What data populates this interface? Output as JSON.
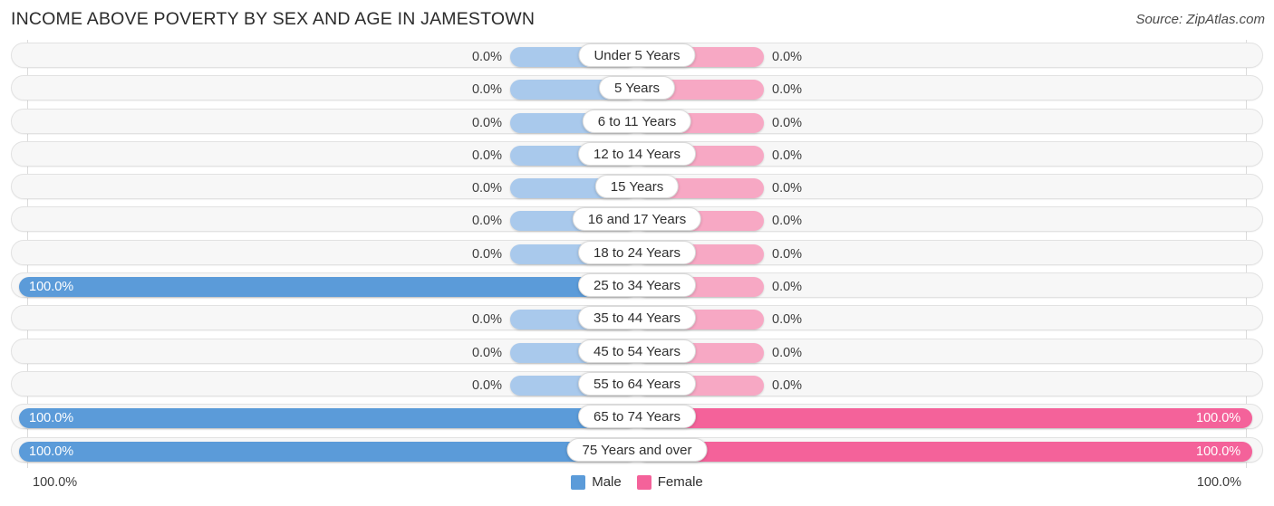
{
  "header": {
    "title": "INCOME ABOVE POVERTY BY SEX AND AGE IN JAMESTOWN",
    "source": "Source: ZipAtlas.com"
  },
  "legend": {
    "male_label": "Male",
    "female_label": "Female",
    "male_color": "#5b9bd9",
    "female_color": "#f4629a",
    "male_zero_color": "#a9c9ec",
    "female_zero_color": "#f7a8c4"
  },
  "axis": {
    "left_label": "100.0%",
    "right_label": "100.0%"
  },
  "chart_data": {
    "type": "bar",
    "subtype": "diverging-bar",
    "title": "INCOME ABOVE POVERTY BY SEX AND AGE IN JAMESTOWN",
    "xlabel": "",
    "ylabel": "",
    "xlim": [
      100.0,
      100.0
    ],
    "grid": true,
    "legend_position": "bottom-center",
    "categories": [
      "Under 5 Years",
      "5 Years",
      "6 to 11 Years",
      "12 to 14 Years",
      "15 Years",
      "16 and 17 Years",
      "18 to 24 Years",
      "25 to 34 Years",
      "35 to 44 Years",
      "45 to 54 Years",
      "55 to 64 Years",
      "65 to 74 Years",
      "75 Years and over"
    ],
    "series": [
      {
        "name": "Male",
        "values": [
          0.0,
          0.0,
          0.0,
          0.0,
          0.0,
          0.0,
          0.0,
          100.0,
          0.0,
          0.0,
          0.0,
          100.0,
          100.0
        ],
        "labels": [
          "0.0%",
          "0.0%",
          "0.0%",
          "0.0%",
          "0.0%",
          "0.0%",
          "0.0%",
          "100.0%",
          "0.0%",
          "0.0%",
          "0.0%",
          "100.0%",
          "100.0%"
        ]
      },
      {
        "name": "Female",
        "values": [
          0.0,
          0.0,
          0.0,
          0.0,
          0.0,
          0.0,
          0.0,
          0.0,
          0.0,
          0.0,
          0.0,
          100.0,
          100.0
        ],
        "labels": [
          "0.0%",
          "0.0%",
          "0.0%",
          "0.0%",
          "0.0%",
          "0.0%",
          "0.0%",
          "0.0%",
          "0.0%",
          "0.0%",
          "0.0%",
          "100.0%",
          "100.0%"
        ]
      }
    ]
  }
}
